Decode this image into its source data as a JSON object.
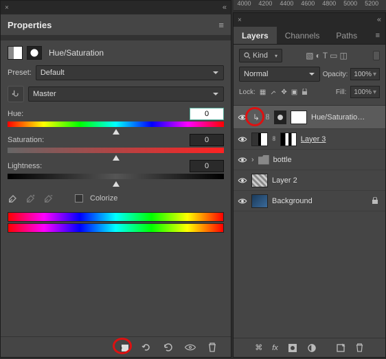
{
  "ruler_ticks": [
    "4000",
    "4200",
    "4400",
    "4600",
    "4800",
    "5000",
    "5200"
  ],
  "properties": {
    "panel_title": "Properties",
    "adjustment_name": "Hue/Saturation",
    "preset_label": "Preset:",
    "preset_value": "Default",
    "channel_value": "Master",
    "sliders": {
      "hue_label": "Hue:",
      "hue_value": "0",
      "sat_label": "Saturation:",
      "sat_value": "0",
      "light_label": "Lightness:",
      "light_value": "0"
    },
    "colorize_label": "Colorize"
  },
  "layers": {
    "tabs": [
      "Layers",
      "Channels",
      "Paths"
    ],
    "kind_label": "Kind",
    "blend_mode": "Normal",
    "opacity_label": "Opacity:",
    "opacity_value": "100%",
    "lock_label": "Lock:",
    "fill_label": "Fill:",
    "fill_value": "100%",
    "items": [
      {
        "name": "Hue/Saturatio…",
        "selected": true
      },
      {
        "name": "Layer 3",
        "underline": true,
        "thumb": "mask"
      },
      {
        "name": "bottle",
        "folder": true
      },
      {
        "name": "Layer 2",
        "thumb": "check"
      },
      {
        "name": "Background",
        "locked": true,
        "thumb": "bg"
      }
    ]
  }
}
